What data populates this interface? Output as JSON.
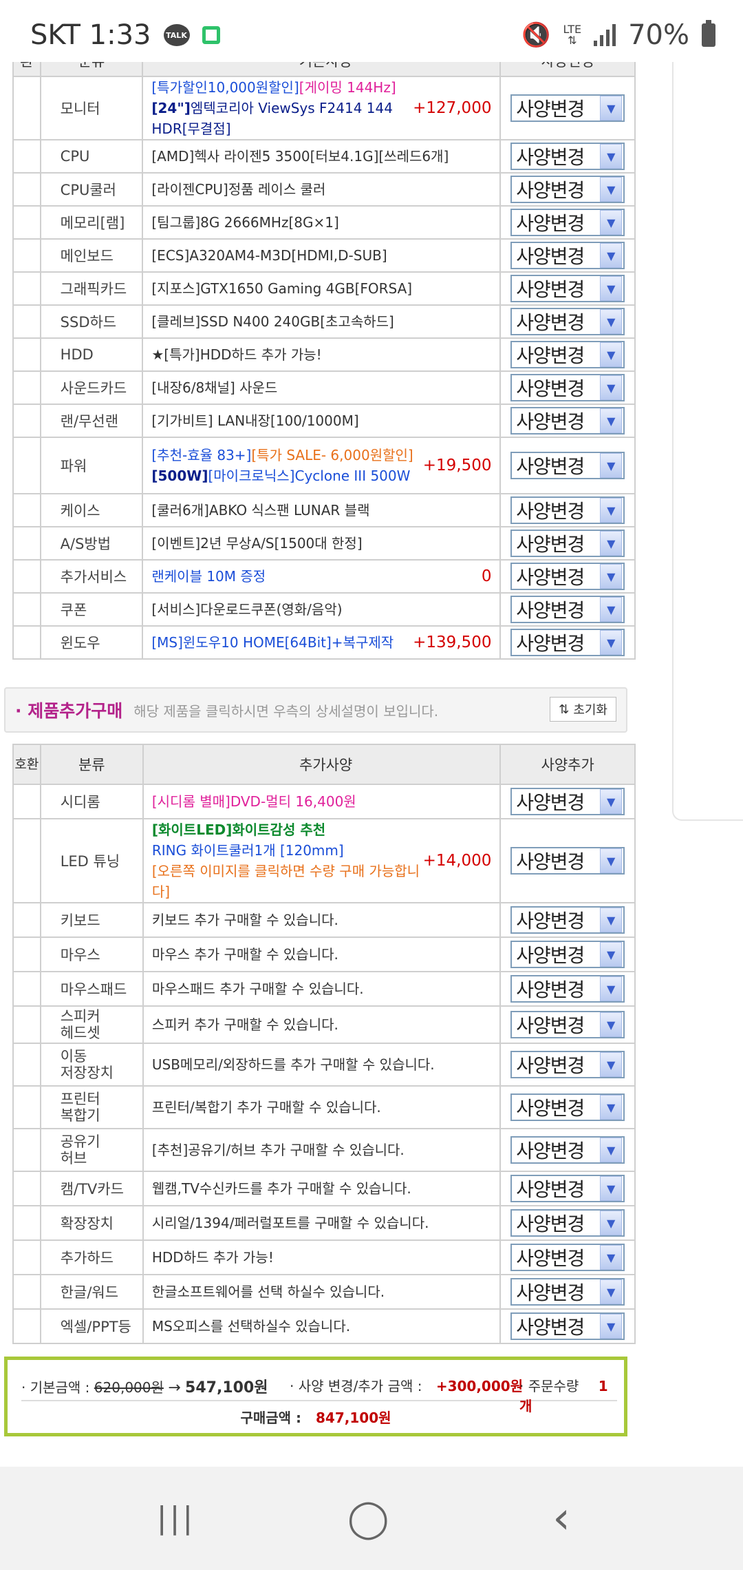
{
  "status": {
    "carrier_time": "SKT 1:33",
    "talk": "TALK",
    "lte": "LTE",
    "battery": "70%"
  },
  "spec_header": {
    "col0": "환",
    "col1": "분류",
    "col2": "기본사양",
    "col3": "사양변경"
  },
  "select_label": "사양변경",
  "spec_rows": [
    {
      "cat": "모니터",
      "l1a": "[특가할인10,000원할인]",
      "l1b": "[게이밍 144Hz]",
      "l2a": "[24\"]",
      "l2b": "엠텍코리아 ViewSys F2414 144 HDR[무결점]",
      "price": "+127,000"
    },
    {
      "cat": "CPU",
      "text": "[AMD]헥사 라이젠5 3500[터보4.1G][쓰레드6개]"
    },
    {
      "cat": "CPU쿨러",
      "text": "[라이젠CPU]정품 레이스 쿨러"
    },
    {
      "cat": "메모리[램]",
      "text": "[팀그룹]8G 2666MHz[8G×1]"
    },
    {
      "cat": "메인보드",
      "text": "[ECS]A320AM4-M3D[HDMI,D-SUB]"
    },
    {
      "cat": "그래픽카드",
      "text": "[지포스]GTX1650 Gaming 4GB[FORSA]"
    },
    {
      "cat": "SSD하드",
      "text": "[클레브]SSD N400 240GB[초고속하드]"
    },
    {
      "cat": "HDD",
      "text": "★[특가]HDD하드 추가 가능!"
    },
    {
      "cat": "사운드카드",
      "text": "[내장6/8채널] 사운드"
    },
    {
      "cat": "랜/무선랜",
      "text": "[기가비트] LAN내장[100/1000M]"
    },
    {
      "cat": "파워",
      "l1a": "[추천-효율 83+]",
      "l1b": "[특가 SALE- 6,000원할인]",
      "l2a": "[500W]",
      "l2b": "[마이크로닉스]Cyclone III 500W",
      "price": "+19,500"
    },
    {
      "cat": "케이스",
      "text": "[쿨러6개]ABKO 식스팬 LUNAR 블랙"
    },
    {
      "cat": "A/S방법",
      "text": "[이벤트]2년 무상A/S[1500대 한정]"
    },
    {
      "cat": "추가서비스",
      "text": "랜케이블 10M 증정",
      "price": "0"
    },
    {
      "cat": "쿠폰",
      "text": "[서비스]다운로드쿠폰(영화/음악)"
    },
    {
      "cat": "윈도우",
      "text": "[MS]윈도우10 HOME[64Bit]+복구제작",
      "price": "+139,500"
    }
  ],
  "add_bar": {
    "title": "· 제품추가구매",
    "hint": "해당 제품을 클릭하시면 우측의 상세설명이 보입니다.",
    "reset": "초기화"
  },
  "add_header": {
    "col0": "호환",
    "col1": "분류",
    "col2": "추가사양",
    "col3": "사양추가"
  },
  "add_rows": [
    {
      "cat": "시디롬",
      "text": "[시디롬 별매]DVD-멀티 16,400원"
    },
    {
      "cat": "LED 튜닝",
      "l1a": "[화이트LED]",
      "l1b": "화이트감성 추천",
      "l2": "RING 화이트쿨러1개 [120mm]",
      "l3": "[오른쪽 이미지를 클릭하면 수량 구매 가능합니다]",
      "price": "+14,000"
    },
    {
      "cat": "키보드",
      "text": "키보드 추가 구매할 수 있습니다."
    },
    {
      "cat": "마우스",
      "text": "마우스 추가 구매할 수 있습니다."
    },
    {
      "cat": "마우스패드",
      "text": "마우스패드 추가 구매할 수 있습니다."
    },
    {
      "cat1": "스피커",
      "cat2": "헤드셋",
      "text": "스피커 추가 구매할 수 있습니다."
    },
    {
      "cat1": "이동",
      "cat2": "저장장치",
      "text": "USB메모리/외장하드를 추가 구매할 수 있습니다."
    },
    {
      "cat1": "프린터",
      "cat2": "복합기",
      "text": "프린터/복합기 추가 구매할 수 있습니다."
    },
    {
      "cat1": "공유기",
      "cat2": "허브",
      "text": "[추천]공유기/허브 추가 구매할 수 있습니다."
    },
    {
      "cat": "캠/TV카드",
      "text": "웹캠,TV수신카드를 추가 구매할 수 있습니다."
    },
    {
      "cat": "확장장치",
      "text": "시리얼/1394/페러럴포트를 구매할 수 있습니다."
    },
    {
      "cat": "추가하드",
      "text": "HDD하드 추가 가능!"
    },
    {
      "cat": "한글/워드",
      "text": "한글소프트웨어를 선택 하실수 있습니다."
    },
    {
      "cat": "엑셀/PPT등",
      "text": "MS오피스를 선택하실수 있습니다."
    }
  ],
  "summary": {
    "base_label": "· 기본금액 :",
    "base_old": "620,000원",
    "arrow": "→",
    "base_new": "547,100원",
    "change_label": "· 사양 변경/추가 금액 :",
    "change_value": "+300,000원",
    "qty_label": "· 주문수량",
    "qty_value": "1 개",
    "total_label": "구매금액 :",
    "total_value": "847,100원"
  },
  "nav": {
    "recent": "|||",
    "home": "◯",
    "back": "‹"
  }
}
